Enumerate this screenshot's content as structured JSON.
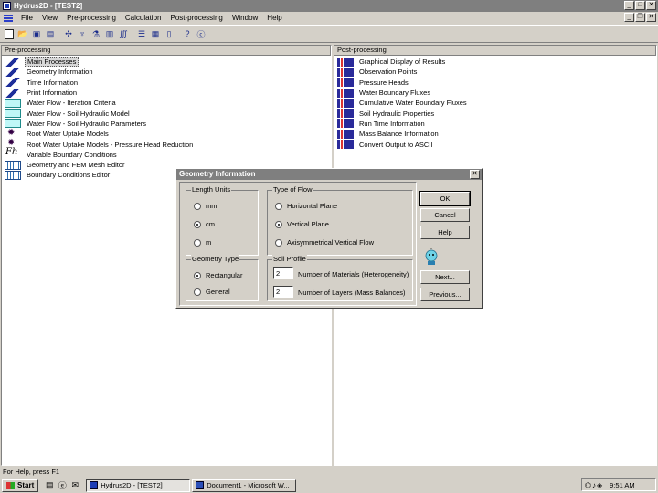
{
  "window": {
    "title": "Hydrus2D - [TEST2]"
  },
  "menu": [
    "File",
    "View",
    "Pre-processing",
    "Calculation",
    "Post-processing",
    "Window",
    "Help"
  ],
  "pre_processing": {
    "header": "Pre-processing",
    "items": [
      {
        "label": "Main Processes",
        "icon": "pencil-icon",
        "selected": true
      },
      {
        "label": "Geometry Information",
        "icon": "pencil-icon"
      },
      {
        "label": "Time Information",
        "icon": "pencil-icon"
      },
      {
        "label": "Print Information",
        "icon": "pencil-icon"
      },
      {
        "label": "Water Flow - Iteration Criteria",
        "icon": "rect-icon"
      },
      {
        "label": "Water Flow - Soil Hydraulic Model",
        "icon": "rect-icon"
      },
      {
        "label": "Water Flow - Soil Hydraulic Parameters",
        "icon": "rect-icon"
      },
      {
        "label": "Root Water Uptake Models",
        "icon": "gear-icon"
      },
      {
        "label": "Root Water Uptake Models - Pressure Head Reduction",
        "icon": "gear-icon"
      },
      {
        "label": "Variable Boundary Conditions",
        "icon": "function-icon"
      },
      {
        "label": "Geometry and FEM Mesh Editor",
        "icon": "mesh-icon"
      },
      {
        "label": "Boundary Conditions Editor",
        "icon": "mesh-icon"
      }
    ]
  },
  "post_processing": {
    "header": "Post-processing",
    "items": [
      {
        "label": "Graphical Display of Results"
      },
      {
        "label": "Observation Points"
      },
      {
        "label": "Pressure Heads"
      },
      {
        "label": "Water Boundary Fluxes"
      },
      {
        "label": "Cumulative Water Boundary Fluxes"
      },
      {
        "label": "Soil Hydraulic Properties"
      },
      {
        "label": "Run Time Information"
      },
      {
        "label": "Mass Balance Information"
      },
      {
        "label": "Convert Output to ASCII"
      }
    ]
  },
  "status": "For Help, press F1",
  "taskbar": {
    "start": "Start",
    "tasks": [
      {
        "label": "Hydrus2D - [TEST2]",
        "active": true
      },
      {
        "label": "Document1 - Microsoft W...",
        "active": false
      }
    ],
    "clock": "9:51 AM"
  },
  "dialog": {
    "title": "Geometry Information",
    "length_units": {
      "title": "Length Units",
      "options": [
        {
          "label": "mm",
          "checked": false
        },
        {
          "label": "cm",
          "checked": true
        },
        {
          "label": "m",
          "checked": false
        }
      ]
    },
    "type_of_flow": {
      "title": "Type of Flow",
      "options": [
        {
          "label": "Horizontal Plane",
          "checked": false
        },
        {
          "label": "Vertical Plane",
          "checked": true
        },
        {
          "label": "Axisymmetrical Vertical Flow",
          "checked": false
        }
      ]
    },
    "geometry_type": {
      "title": "Geometry Type",
      "options": [
        {
          "label": "Rectangular",
          "checked": true
        },
        {
          "label": "General",
          "checked": false
        }
      ]
    },
    "soil_profile": {
      "title": "Soil Profile",
      "materials_value": "2",
      "materials_label": "Number of Materials (Heterogeneity)",
      "layers_value": "2",
      "layers_label": "Number of Layers (Mass Balances)"
    },
    "buttons": {
      "ok": "OK",
      "cancel": "Cancel",
      "help": "Help",
      "next": "Next...",
      "previous": "Previous..."
    }
  }
}
